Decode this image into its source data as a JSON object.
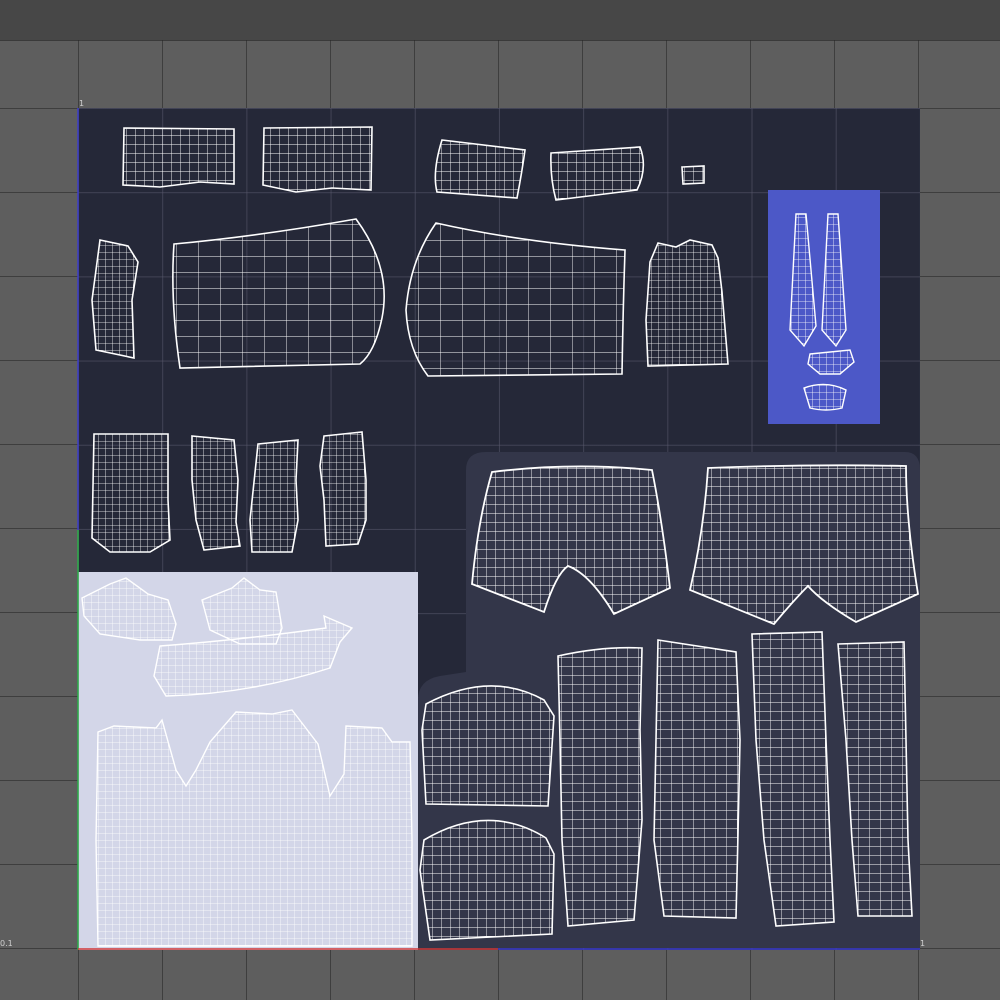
{
  "window": {
    "top_label": "",
    "tile_label_top": "1",
    "tile_label_left": "0.1",
    "tile_label_right": "1"
  },
  "colors": {
    "background": "#5e5e5e",
    "uv_tile": "#252838",
    "wire": "#ffffff",
    "selected_block": "#4c58c7",
    "selection_region": "#d3d6e8",
    "axis_u": "#d13a3a",
    "axis_v": "#2fa84a",
    "axis_blue": "#3b3bd0"
  },
  "uv_islands": [
    "strap-top-left-1",
    "strap-top-left-2",
    "strap-top-mid-1",
    "strap-top-mid-2",
    "small-tab",
    "side-panel-small",
    "back-panel-left",
    "back-panel-right",
    "vest-piece",
    "tie-selected-block",
    "lower-piece-1",
    "lower-piece-2",
    "lower-piece-3",
    "lower-piece-4",
    "shorts-back",
    "shorts-front",
    "shirt-collar-group",
    "shirt-body",
    "seat-patch-top",
    "seat-patch-bottom",
    "leg-strip-1",
    "leg-strip-2",
    "leg-strip-3",
    "leg-strip-4"
  ]
}
